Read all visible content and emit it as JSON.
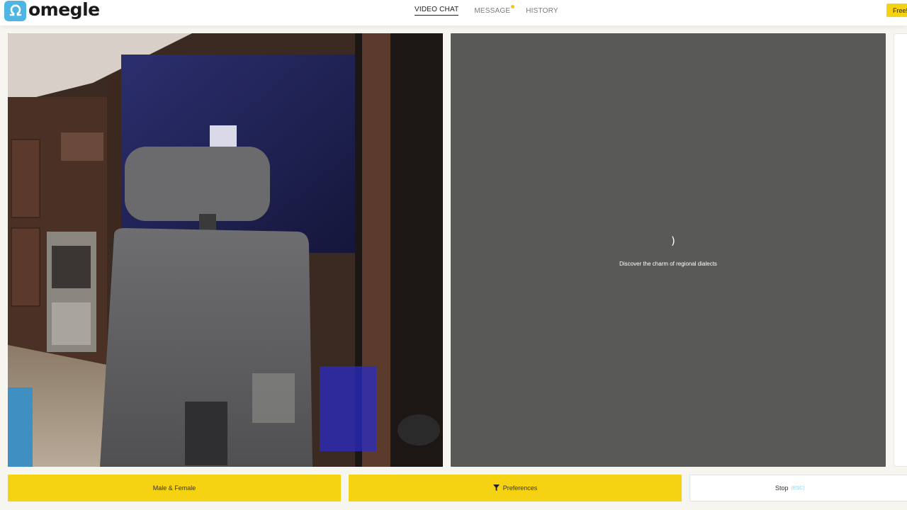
{
  "header": {
    "logo_text": "omegle",
    "nav": [
      {
        "label": "VIDEO CHAT",
        "active": true
      },
      {
        "label": "MESSAGE",
        "active": false,
        "has_notification": true
      },
      {
        "label": "HISTORY",
        "active": false
      }
    ],
    "free_button_label": "Free!"
  },
  "remote_video": {
    "status_text": "Discover the charm of regional dialects",
    "spinner_glyph": ")"
  },
  "controls": {
    "gender_label": "Male & Female",
    "preferences_label": "Preferences",
    "stop_label": "Stop",
    "stop_shortcut": "(ESC)"
  },
  "colors": {
    "accent_yellow": "#f5d312",
    "brand_blue": "#4fb6e3",
    "remote_bg": "#595a58"
  },
  "icons": {
    "logo": "omega-icon",
    "preferences": "filter-icon"
  }
}
